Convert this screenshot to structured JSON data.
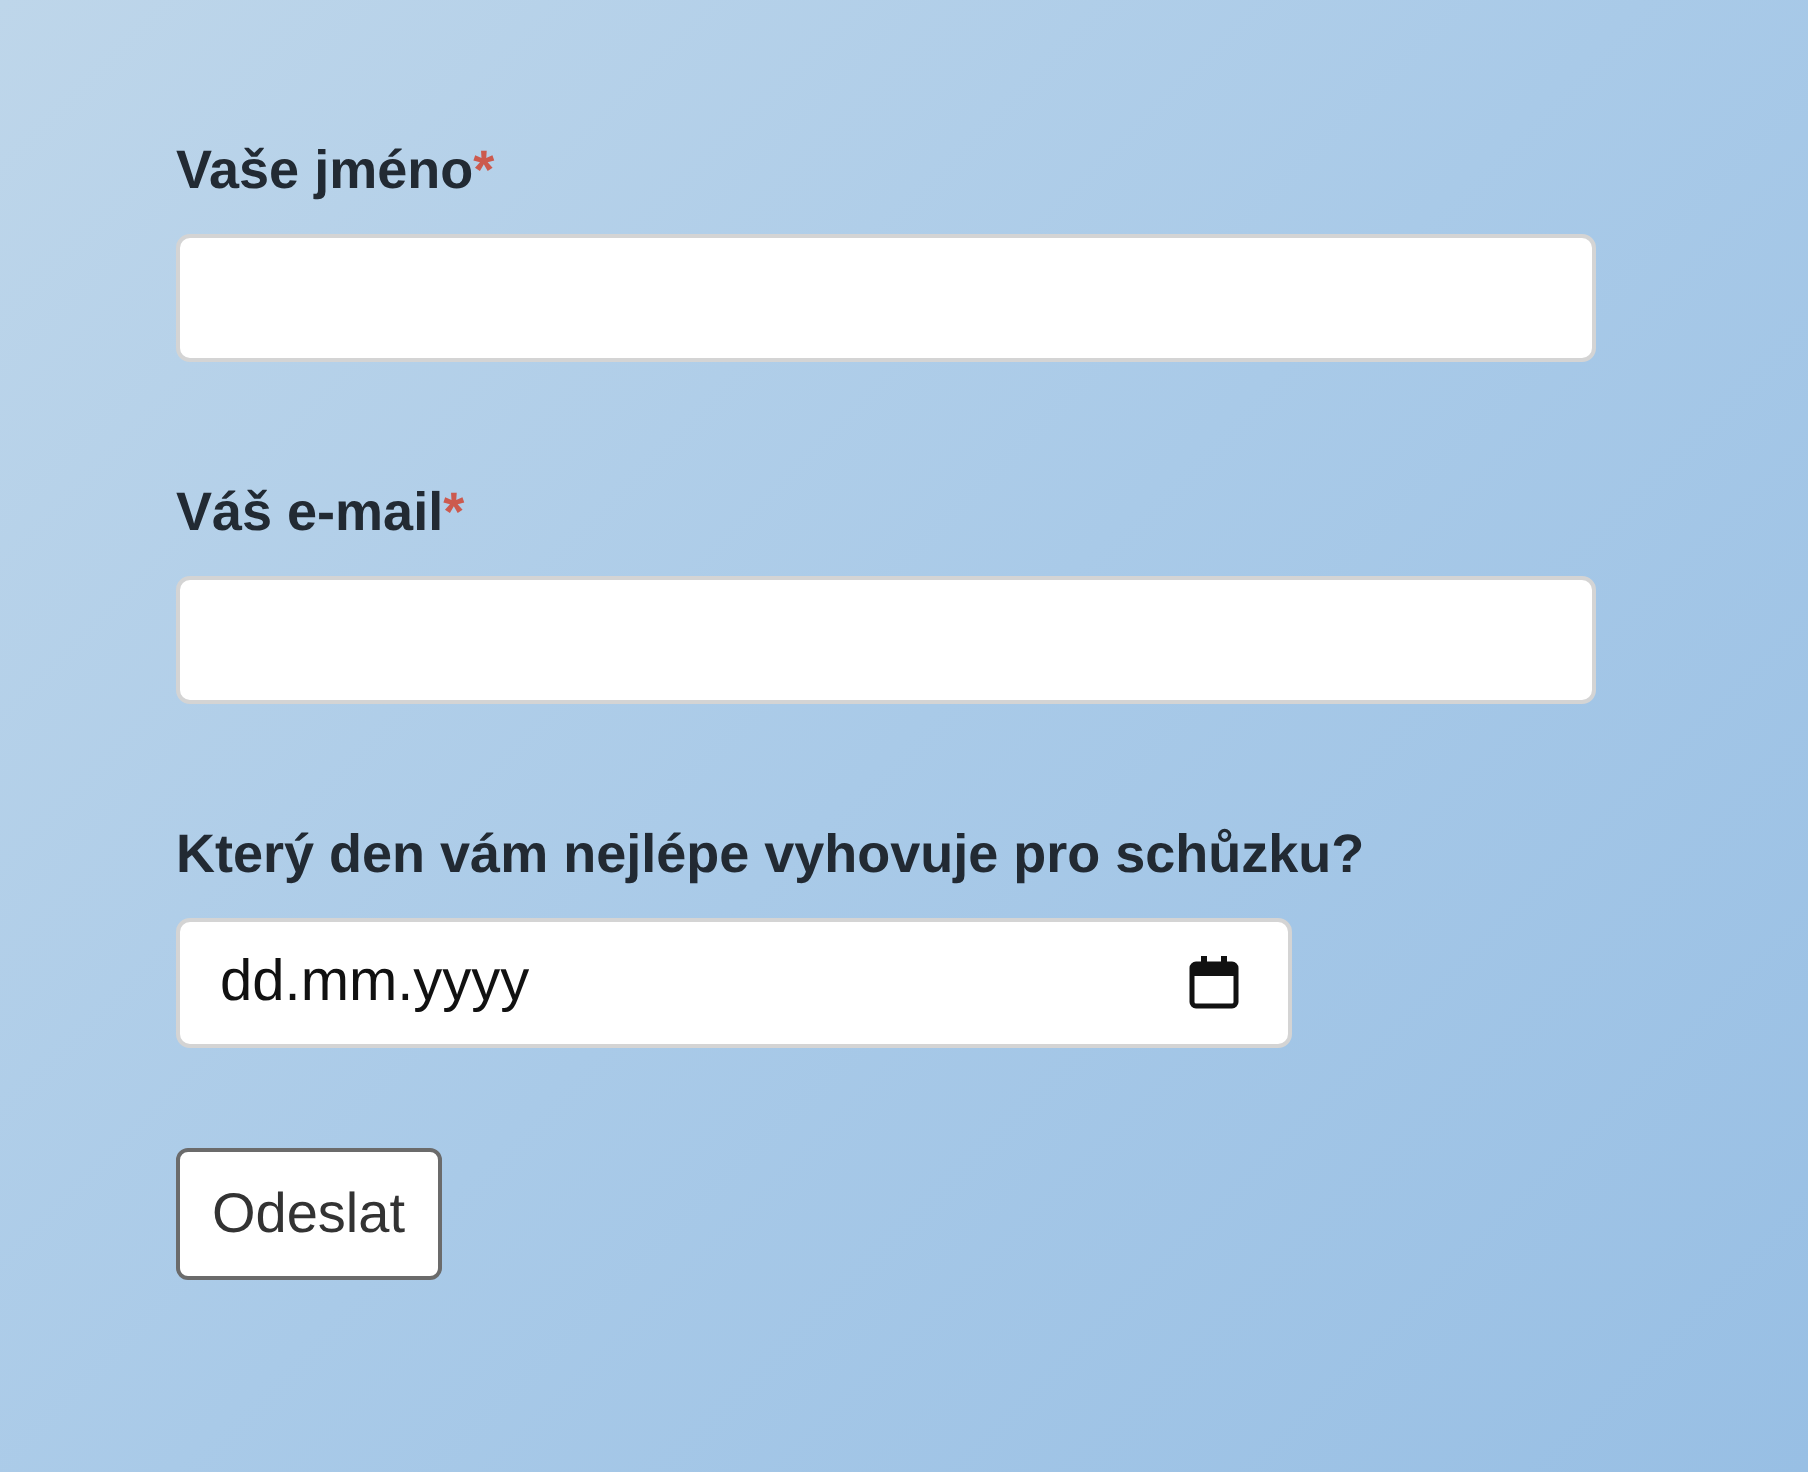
{
  "form": {
    "fields": [
      {
        "kind": "text",
        "label": "Vaše jméno",
        "required_mark": "*"
      },
      {
        "kind": "email",
        "label": "Váš e-mail",
        "required_mark": "*"
      },
      {
        "kind": "date",
        "label": "Který den vám nejlépe vyhovuje pro schůzku?",
        "placeholder": "dd.mm.yyyy"
      }
    ],
    "submit": "Odeslat"
  }
}
